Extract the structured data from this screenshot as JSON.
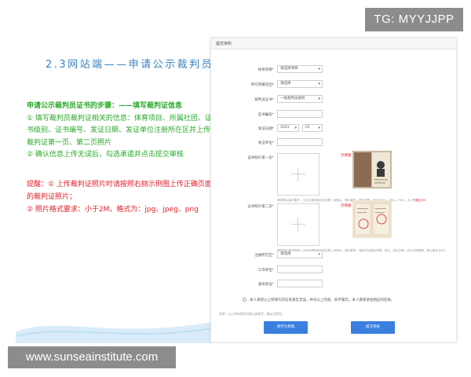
{
  "watermarks": {
    "top_right": "TG: MYYJJPP",
    "bottom_left": "www.sunseainstitute.com"
  },
  "slide": {
    "title": "2.3网站端——申请公示裁判员证书",
    "steps_heading": "申请公示裁判员证书的步骤：——填写裁判证信息",
    "step1": "① 填写裁判员裁判证相关的信息：体育项目、所属社团、证书级别、证书编号、发证日期、发证单位注册所在区并上传裁判证第一页、第二页照片",
    "step2": "② 确认信息上传无误后，勾选承诺并点击提交审核",
    "note1": "提醒：① 上传裁判证照片时请按照右侧示例图上传正确页面的裁判证照片；",
    "note2": "② 照片格式要求：小于2M，格式为：jpg、jpeg、png"
  },
  "form": {
    "header": "提交资料",
    "fields": {
      "sport": {
        "label": "体育项目",
        "value": "请选择项目"
      },
      "org": {
        "label": "所在所属社团",
        "value": "请选择"
      },
      "level": {
        "label": "裁判员证书",
        "value": "一级裁判员级别"
      },
      "cert_no": {
        "label": "证书编号",
        "value": ""
      },
      "issue_date": {
        "label": "发证日期",
        "year": "2021",
        "month": "01"
      },
      "issuer": {
        "label": "发证单位",
        "value": ""
      },
      "photo1": {
        "label": "证书照片第一页",
        "example_label": "示例图"
      },
      "photo1_hint": "请将照片裁切整齐，上传正确的裁判员证第一页照片，照片要求：照片清晰、格式为JPG、JPEG、PNG，大小",
      "photo1_hint_red": "不超过2M",
      "photo2": {
        "label": "证书照片第二页",
        "example_label": "示例图"
      },
      "photo2_hint": "请将照片裁切整齐，上传正确的裁判员证第二页照片，照片要求：裁判员证等级详情、单位、发证日期、发证日期清楚，照片格式为JPG、JPEG、PNG，",
      "photo2_hint_red": "大小不超过2M",
      "district": {
        "label": "注册所在区",
        "value": "请选择"
      },
      "workplace": {
        "label": "工作单位",
        "value": ""
      },
      "address": {
        "label": "通讯地址",
        "value": ""
      }
    },
    "agreement": "本人承诺以上所填写的信息真实无误，并对以上内容，如不属实，本人愿意承担相应的后果。",
    "footer_note": "说明：以上所有资料均需认真填写，确认后提交。",
    "buttons": {
      "save": "保存为草稿",
      "submit": "提交审核"
    }
  }
}
